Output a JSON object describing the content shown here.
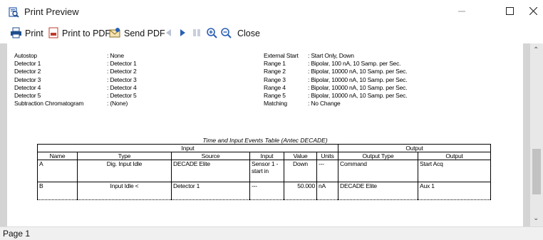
{
  "window": {
    "title": "Print Preview"
  },
  "toolbar": {
    "print_label": "Print",
    "print_pdf_label": "Print to PDF",
    "send_pdf_label": "Send PDF",
    "close_label": "Close"
  },
  "settings_left": [
    {
      "label": "Autostop",
      "value": ": None"
    },
    {
      "label": "Detector 1",
      "value": ": Detector 1"
    },
    {
      "label": "Detector 2",
      "value": ": Detector 2"
    },
    {
      "label": "Detector 3",
      "value": ": Detector 3"
    },
    {
      "label": "Detector 4",
      "value": ": Detector 4"
    },
    {
      "label": "Detector 5",
      "value": ": Detector 5"
    },
    {
      "label": "Subtraction Chromatogram",
      "value": ": (None)"
    }
  ],
  "settings_right": [
    {
      "label": "External Start",
      "value": ": Start Only, Down"
    },
    {
      "label": "Range 1",
      "value": ": Bipolar, 100 nA, 10 Samp. per Sec."
    },
    {
      "label": "Range 2",
      "value": ": Bipolar, 10000 nA, 10 Samp. per Sec."
    },
    {
      "label": "Range 3",
      "value": ": Bipolar, 10000 nA, 10 Samp. per Sec."
    },
    {
      "label": "Range 4",
      "value": ": Bipolar, 10000 nA, 10 Samp. per Sec."
    },
    {
      "label": "Range 5",
      "value": ": Bipolar, 10000 nA, 10 Samp. per Sec."
    },
    {
      "label": "Matching",
      "value": ": No Change"
    }
  ],
  "events_table": {
    "caption": "Time and Input Events Table (Antec DECADE)",
    "group_input": "Input",
    "group_output": "Output",
    "columns": [
      "Name",
      "Type",
      "Source",
      "Input",
      "Value",
      "Units",
      "Output Type",
      "Output"
    ],
    "rows": [
      {
        "name": "A",
        "type": "Dig. Input Idle",
        "source": "DECADE Elite",
        "input": "Sensor 1 - start in",
        "value": "Down",
        "units": "---",
        "output_type": "Command",
        "output": "Start Acq"
      },
      {
        "name": "B",
        "type": "Input Idle <",
        "source": "Detector 1",
        "input": "---",
        "value": "50.000",
        "units": "nA",
        "output_type": "DECADE Elite",
        "output": "Aux 1"
      }
    ]
  },
  "status": {
    "page": "Page 1"
  },
  "colors": {
    "pdf_red": "#c0392b",
    "zoom_blue": "#2b5fb3",
    "print_icon": "#1f4e8c",
    "arrow_disabled": "#b9c3d6"
  }
}
